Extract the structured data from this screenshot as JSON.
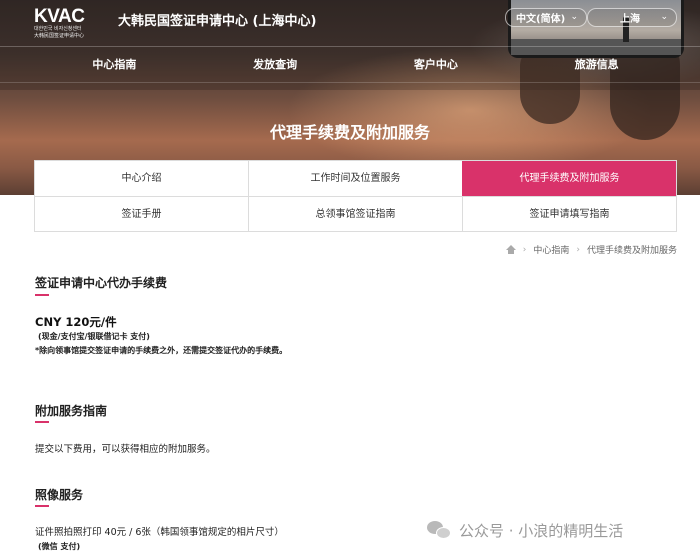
{
  "header": {
    "logo": "KVAC",
    "logo_sub_korean": "대한민국 비자신청센터",
    "logo_sub_chinese": "大韩民国签证申请中心",
    "site_title": "大韩民国签证申请中心 (上海中心)",
    "language_select": "中文(简体)",
    "city_select": "上海"
  },
  "nav": {
    "items": [
      {
        "label": "中心指南"
      },
      {
        "label": "发放查询"
      },
      {
        "label": "客户中心"
      },
      {
        "label": "旅游信息"
      }
    ]
  },
  "hero": {
    "title": "代理手续费及附加服务"
  },
  "tabs": {
    "row1": [
      {
        "label": "中心介绍"
      },
      {
        "label": "工作时间及位置服务"
      },
      {
        "label": "代理手续费及附加服务"
      }
    ],
    "row2": [
      {
        "label": "签证手册"
      },
      {
        "label": "总领事馆签证指南"
      },
      {
        "label": "签证申请填写指南"
      }
    ],
    "active": "代理手续费及附加服务"
  },
  "breadcrumb": {
    "items": [
      "中心指南",
      "代理手续费及附加服务"
    ]
  },
  "content": {
    "fee_title": "签证申请中心代办手续费",
    "fee_price": "CNY 120元/件",
    "fee_payment": "(现金/支付宝/银联借记卡 支付)",
    "fee_note": "*除向领事馆提交签证申请的手续费之外，还需提交签证代办的手续费。",
    "addon_title": "附加服务指南",
    "addon_desc": "提交以下费用，可以获得相应的附加服务。",
    "photo_title": "照像服务",
    "photo_desc": "证件照拍照打印 40元 / 6张（韩国领事馆规定的相片尺寸）",
    "photo_payment": "(微信 支付)"
  },
  "watermark": {
    "text": "公众号 · 小浪的精明生活"
  },
  "colors": {
    "accent": "#d9326a"
  }
}
